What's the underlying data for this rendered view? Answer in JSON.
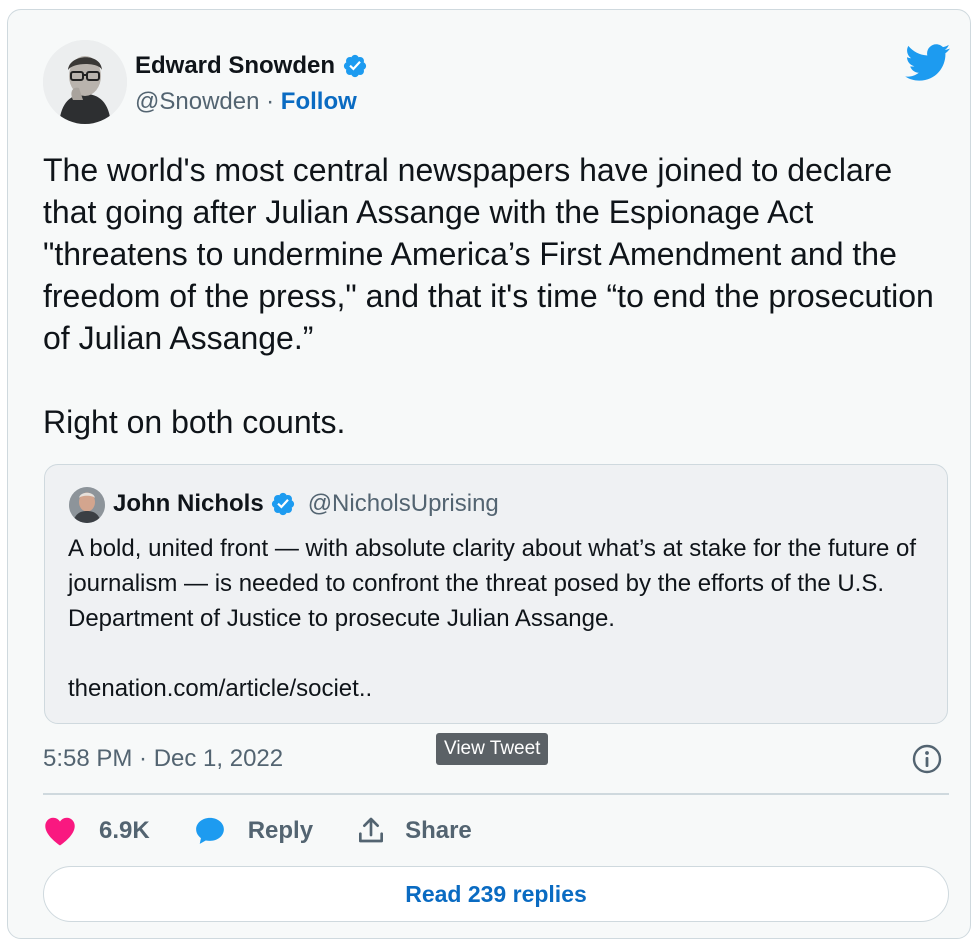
{
  "tweet": {
    "author": {
      "name": "Edward Snowden",
      "handle": "@Snowden",
      "separator": " · ",
      "follow_label": "Follow",
      "verified": true,
      "avatar_icon": "author-avatar-photo"
    },
    "paragraphs": [
      "The world's most central newspapers have joined to declare that going after Julian Assange with the Espionage Act \"threatens to undermine America’s First Amendment and the freedom of the press,\" and that it's time “to end the prosecution of Julian Assange.”",
      "Right on both counts."
    ],
    "quote": {
      "name": "John Nichols",
      "handle": "@NicholsUprising",
      "verified": true,
      "paragraphs": [
        "A bold, united front — with absolute clarity about what’s at stake for the future of journalism — is needed to confront the threat posed by the efforts of the U.S. Department of Justice to prosecute Julian Assange.",
        "thenation.com/article/societ.."
      ]
    },
    "tooltip": "View Tweet",
    "timestamp": "5:58 PM · Dec 1, 2022",
    "actions": {
      "like_count": "6.9K",
      "reply_label": "Reply",
      "share_label": "Share"
    },
    "read_replies_label": "Read 239 replies"
  },
  "colors": {
    "card_background": "#f7f9f9",
    "quote_background": "#eff1f3",
    "border": "#cfd9de",
    "link_blue": "#0a6bc2",
    "twitter_blue": "#1d9bf0",
    "verified_blue": "#1d9bf0",
    "like_pink": "#f91880",
    "muted_text": "#536471",
    "tooltip_background": "#5b6166"
  },
  "icons": {
    "brand": "twitter-bird-icon",
    "verified": "verified-badge-icon",
    "info": "info-icon",
    "like": "heart-icon",
    "reply": "speech-bubble-icon",
    "share": "share-upload-icon"
  }
}
